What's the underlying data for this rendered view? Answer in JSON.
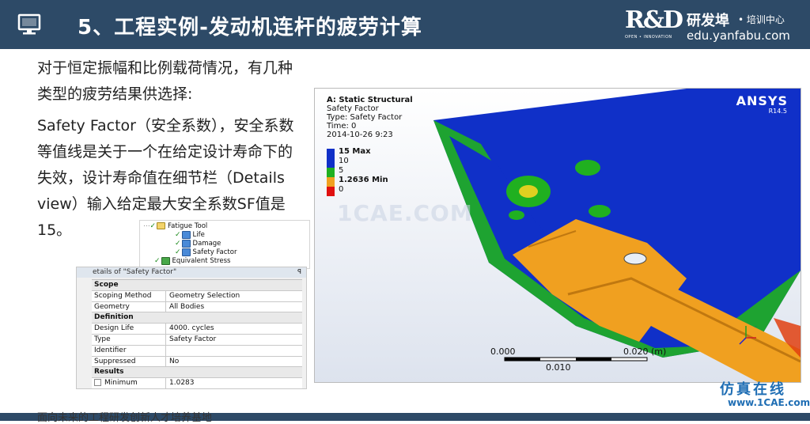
{
  "header": {
    "title": "5、工程实例-发动机连杆的疲劳计算",
    "logo_mark": "R&D",
    "logo_cn": "研发埠",
    "logo_sub": "• 培训中心",
    "logo_url": "edu.yanfabu.com",
    "logo_tagline": "OPEN • INNOVATION"
  },
  "text": {
    "para1": "对于恒定振幅和比例载荷情况，有几种类型的疲劳结果供选择:",
    "para2": "Safety Factor（安全系数），安全系数等值线是关于一个在给定设计寿命下的失效，设计寿命值在细节栏（Details view）输入给定最大安全系数SF值是15。"
  },
  "tree": {
    "root": "Fatigue Tool",
    "items": [
      "Life",
      "Damage",
      "Safety Factor"
    ],
    "extra": "Equivalent Stress"
  },
  "details": {
    "title": "etails of \"Safety Factor\"",
    "pin": "ꟼ",
    "sections": [
      {
        "name": "Scope",
        "rows": [
          {
            "key": "Scoping Method",
            "value": "Geometry Selection"
          },
          {
            "key": "Geometry",
            "value": "All Bodies"
          }
        ]
      },
      {
        "name": "Definition",
        "rows": [
          {
            "key": "Design Life",
            "value": "4000. cycles"
          },
          {
            "key": "Type",
            "value": "Safety Factor"
          },
          {
            "key": "Identifier",
            "value": ""
          },
          {
            "key": "Suppressed",
            "value": "No"
          }
        ]
      },
      {
        "name": "Results",
        "rows": [
          {
            "key": "Minimum",
            "value": "1.0283",
            "checkbox": true
          }
        ]
      }
    ]
  },
  "sim": {
    "title": "A: Static Structural",
    "lines": [
      "Safety Factor",
      "Type: Safety Factor",
      "Time: 0",
      "2014-10-26 9:23"
    ],
    "brand": "ANSYS",
    "version": "R14.5",
    "legend": [
      {
        "label": "15 Max",
        "color": "#1030c8"
      },
      {
        "label": "10",
        "color": "#1030c8"
      },
      {
        "label": "5",
        "color": "#20b020"
      },
      {
        "label": "1.2636 Min",
        "color": "#f0a020"
      },
      {
        "label": "0",
        "color": "#e01010"
      }
    ],
    "scale": {
      "left": "0.000",
      "mid": "0.010",
      "right": "0.020 (m)"
    },
    "watermark": "1CAE.COM"
  },
  "footer": {
    "text": "面向未来的工程研发创新人才培养基地",
    "wm_cn": "仿真在线",
    "wm_url": "www.1CAE.com"
  }
}
